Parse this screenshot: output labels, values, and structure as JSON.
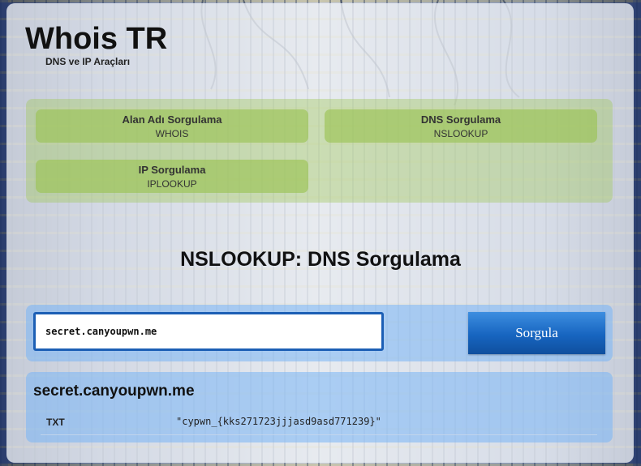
{
  "site": {
    "title": "Whois TR",
    "subtitle": "DNS ve IP Araçları"
  },
  "nav": {
    "items": [
      {
        "label": "Alan Adı Sorgulama",
        "sublabel": "WHOIS"
      },
      {
        "label": "DNS Sorgulama",
        "sublabel": "NSLOOKUP"
      },
      {
        "label": "IP Sorgulama",
        "sublabel": "IPLOOKUP"
      }
    ]
  },
  "main": {
    "page_title": "NSLOOKUP: DNS Sorgulama"
  },
  "search": {
    "value": "secret.canyoupwn.me",
    "button_label": "Sorgula"
  },
  "result": {
    "domain": "secret.canyoupwn.me",
    "records": [
      {
        "type": "TXT",
        "value": "\"cypwn_{kks271723jjjasd9asd771239}\""
      }
    ]
  },
  "colors": {
    "accent_blue": "#1765c0",
    "nav_green": "#9bc355"
  }
}
